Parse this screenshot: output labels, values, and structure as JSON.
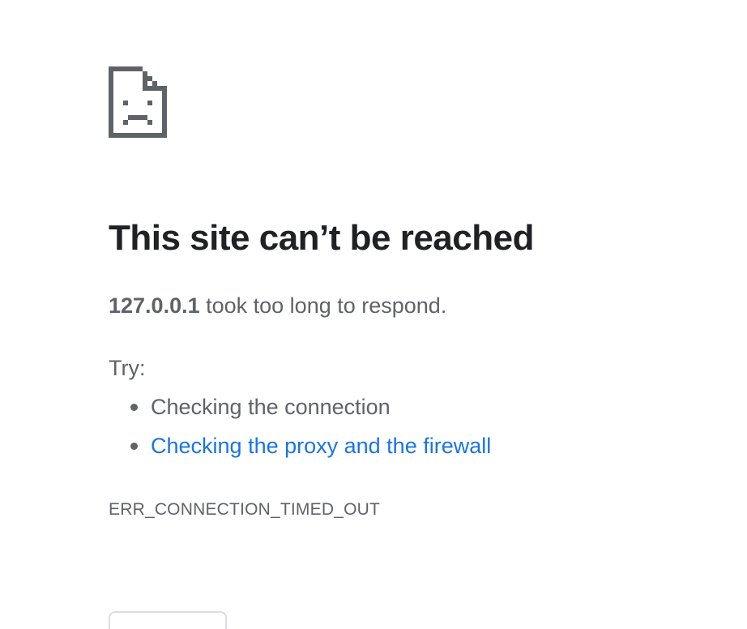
{
  "error_page": {
    "icon": "sad-page-icon",
    "title": "This site can’t be reached",
    "summary": {
      "host": "127.0.0.1",
      "message": " took too long to respond."
    },
    "try_label": "Try:",
    "suggestions": [
      {
        "label": "Checking the connection",
        "is_link": false
      },
      {
        "label": "Checking the proxy and the firewall",
        "is_link": true
      }
    ],
    "error_code": "ERR_CONNECTION_TIMED_OUT",
    "link_color": "#1a73e8",
    "text_color": "#5f6368",
    "title_color": "#202124"
  }
}
